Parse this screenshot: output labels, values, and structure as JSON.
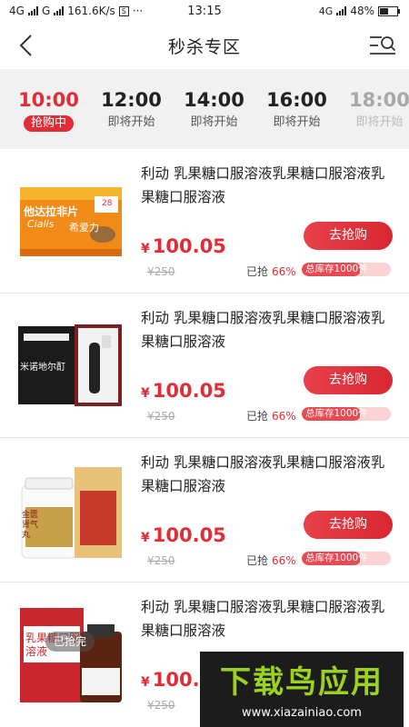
{
  "status_bar": {
    "network1": "4G",
    "network2": "G",
    "speed": "161.6K/s",
    "s_icon": "S",
    "time": "13:15",
    "lte": "4G",
    "battery": "48%",
    "battery_level": 0.48
  },
  "header": {
    "title": "秒杀专区",
    "back_icon": "chevron-left-icon",
    "menu_icon": "menu-search-icon"
  },
  "tabs": [
    {
      "time": "10:00",
      "label": "抢购中"
    },
    {
      "time": "12:00",
      "label": "即将开始"
    },
    {
      "time": "14:00",
      "label": "即将开始"
    },
    {
      "time": "16:00",
      "label": "即将开始"
    },
    {
      "time": "18:00",
      "label": "即将开始"
    }
  ],
  "products": [
    {
      "title": "利动 乳果糖口服溶液乳果糖口服溶液乳果糖口服溶液",
      "currency": "¥",
      "price": "100.05",
      "orig_price": "¥250",
      "sold_label": "已抢",
      "sold_pct": "66%",
      "stock_text": "总库存1000件",
      "stock_ratio": 0.66,
      "button": "去抢购",
      "box_brand": "他达拉非片",
      "box_brand_en": "Cialis",
      "box_cn": "希爱力",
      "box_count": "28"
    },
    {
      "title": "利动 乳果糖口服溶液乳果糖口服溶液乳果糖口服溶液",
      "currency": "¥",
      "price": "100.05",
      "orig_price": "¥250",
      "sold_label": "已抢",
      "sold_pct": "66%",
      "stock_text": "总库存1000件",
      "stock_ratio": 0.66,
      "button": "去抢购",
      "box_brand": "米诺地尔酊"
    },
    {
      "title": "利动 乳果糖口服溶液乳果糖口服溶液乳果糖口服溶液",
      "currency": "¥",
      "price": "100.05",
      "orig_price": "¥250",
      "sold_label": "已抢",
      "sold_pct": "66%",
      "stock_text": "总库存1000件",
      "stock_ratio": 0.66,
      "button": "去抢购",
      "box_brand": "金匮肾气丸"
    },
    {
      "title": "利动 乳果糖口服溶液乳果糖口服溶液乳果糖口服溶液",
      "currency": "¥",
      "price": "100.0",
      "orig_price": "¥250",
      "soldout": "已抢完",
      "box_brand": "乳果糖口服溶液"
    }
  ],
  "watermark": {
    "logo": "下载鸟应用",
    "url": "www.xiazainiao.com"
  },
  "colors": {
    "accent": "#e02d37",
    "tab_bg": "#f1f1f1"
  }
}
